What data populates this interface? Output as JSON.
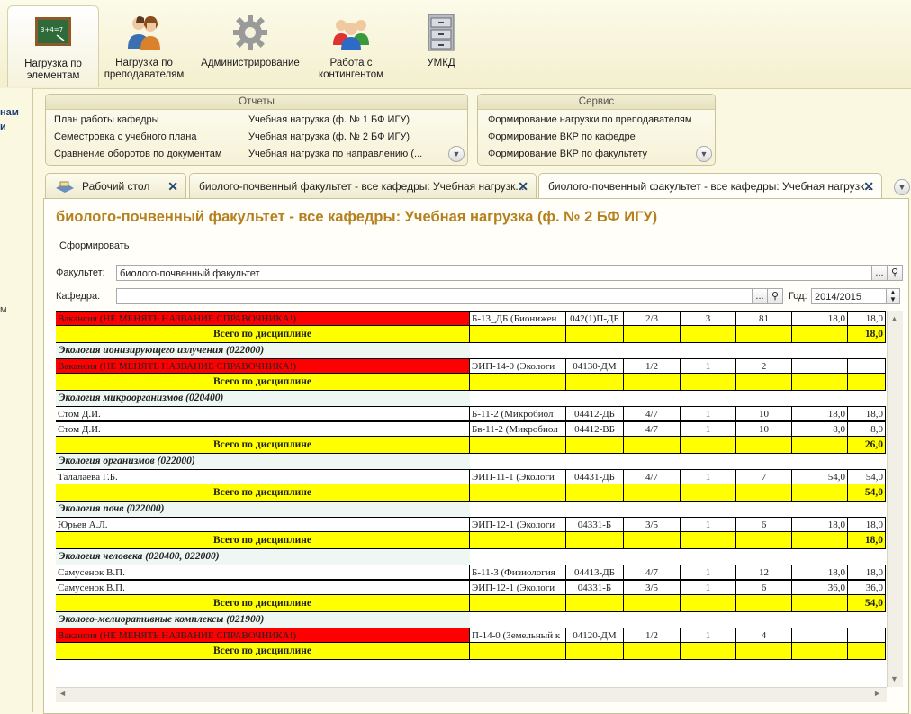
{
  "ribbon": {
    "items": [
      {
        "label": "Нагрузка по элементам",
        "icon": "chalkboard-icon"
      },
      {
        "label": "Нагрузка по преподавателям",
        "icon": "teachers-icon"
      },
      {
        "label": "Администрирование",
        "icon": "gear-icon"
      },
      {
        "label": "Работа с контингентом",
        "icon": "students-icon"
      },
      {
        "label": "УМКД",
        "icon": "cabinet-icon"
      }
    ],
    "chalkboard_text": "3+4=7"
  },
  "left_strip": {
    "line1": "нам",
    "line2": "и",
    "line3": "м"
  },
  "reports": {
    "title": "Отчеты",
    "col1": [
      "План работы кафедры",
      "Семестровка с учебного плана",
      "Сравнение оборотов по документам"
    ],
    "col2": [
      "Учебная нагрузка (ф. № 1 БФ ИГУ)",
      "Учебная нагрузка (ф. № 2 БФ ИГУ)",
      "Учебная нагрузка по направлению (..."
    ]
  },
  "service": {
    "title": "Сервис",
    "items": [
      "Формирование нагрузки по преподавателям",
      "Формирование ВКР по кафедре",
      "Формирование ВКР по факультету"
    ]
  },
  "tabs": [
    {
      "label": "Рабочий стол"
    },
    {
      "label": "биолого-почвенный факультет - все кафедры: Учебная нагрузк..."
    },
    {
      "label": "биолого-почвенный факультет - все кафедры: Учебная нагрузк..."
    }
  ],
  "form": {
    "title": "биолого-почвенный факультет - все кафедры: Учебная нагрузка (ф. № 2 БФ ИГУ)",
    "generate_label": "Сформировать",
    "faculty_label": "Факультет:",
    "faculty_value": "биолого-почвенный факультет",
    "department_label": "Кафедра:",
    "department_value": "",
    "year_label": "Год:",
    "year_value": "2014/2015",
    "dots": "..."
  },
  "grid": {
    "rows": [
      {
        "type": "data",
        "name": "Вакансия (НЕ МЕНЯТЬ НАЗВАНИЕ СПРАВОЧНИКА!)",
        "red": true,
        "group": "Б-13_ДБ (Бионижен",
        "code": "042(1)П-ДБ",
        "course": "2/3",
        "c1": "3",
        "c2": "81",
        "c3": "18,0",
        "c4": "18,0"
      },
      {
        "type": "total",
        "label": "Всего по дисциплине",
        "value": "18,0"
      },
      {
        "type": "header",
        "label": "Экология ионизирующего излучения (022000)"
      },
      {
        "type": "data",
        "name": "Вакансия (НЕ МЕНЯТЬ НАЗВАНИЕ СПРАВОЧНИКА!)",
        "red": true,
        "group": "ЭИП-14-0 (Экологи",
        "code": "04130-ДМ",
        "course": "1/2",
        "c1": "1",
        "c2": "2",
        "c3": "",
        "c4": ""
      },
      {
        "type": "total",
        "label": "Всего по дисциплине",
        "value": ""
      },
      {
        "type": "header",
        "label": "Экология микроорганизмов (020400)"
      },
      {
        "type": "data",
        "name": "Стом Д.И.",
        "red": false,
        "group": "Б-11-2 (Микробиол",
        "code": "04412-ДБ",
        "course": "4/7",
        "c1": "1",
        "c2": "10",
        "c3": "18,0",
        "c4": "18,0"
      },
      {
        "type": "data",
        "name": "Стом Д.И.",
        "red": false,
        "group": "Бв-11-2 (Микробиол",
        "code": "04412-ВБ",
        "course": "4/7",
        "c1": "1",
        "c2": "10",
        "c3": "8,0",
        "c4": "8,0"
      },
      {
        "type": "total",
        "label": "Всего по дисциплине",
        "value": "26,0"
      },
      {
        "type": "header",
        "label": "Экология организмов (022000)"
      },
      {
        "type": "data",
        "name": "Талалаева Г.Б.",
        "red": false,
        "group": "ЭИП-11-1 (Экологи",
        "code": "04431-ДБ",
        "course": "4/7",
        "c1": "1",
        "c2": "7",
        "c3": "54,0",
        "c4": "54,0"
      },
      {
        "type": "total",
        "label": "Всего по дисциплине",
        "value": "54,0"
      },
      {
        "type": "header",
        "label": "Экология почв (022000)"
      },
      {
        "type": "data",
        "name": "Юрьев А.Л.",
        "red": false,
        "group": "ЭИП-12-1 (Экологи",
        "code": "04331-Б",
        "course": "3/5",
        "c1": "1",
        "c2": "6",
        "c3": "18,0",
        "c4": "18,0"
      },
      {
        "type": "total",
        "label": "Всего по дисциплине",
        "value": "18,0"
      },
      {
        "type": "header",
        "label": "Экология человека (020400, 022000)"
      },
      {
        "type": "data",
        "name": "Самусенок В.П.",
        "red": false,
        "group": "Б-11-3 (Физиология",
        "code": "04413-ДБ",
        "course": "4/7",
        "c1": "1",
        "c2": "12",
        "c3": "18,0",
        "c4": "18,0"
      },
      {
        "type": "data",
        "name": "Самусенок В.П.",
        "red": false,
        "group": "ЭИП-12-1 (Экологи",
        "code": "04331-Б",
        "course": "3/5",
        "c1": "1",
        "c2": "6",
        "c3": "36,0",
        "c4": "36,0"
      },
      {
        "type": "total",
        "label": "Всего по дисциплине",
        "value": "54,0"
      },
      {
        "type": "header",
        "label": "Эколого-мелиоративные комплексы   (021900)"
      },
      {
        "type": "data",
        "name": "Вакансия (НЕ МЕНЯТЬ НАЗВАНИЕ СПРАВОЧНИКА!)",
        "red": true,
        "group": "П-14-0 (Земельный к",
        "code": "04120-ДМ",
        "course": "1/2",
        "c1": "1",
        "c2": "4",
        "c3": "",
        "c4": ""
      },
      {
        "type": "total",
        "label": "Всего по дисциплине",
        "value": ""
      }
    ]
  }
}
